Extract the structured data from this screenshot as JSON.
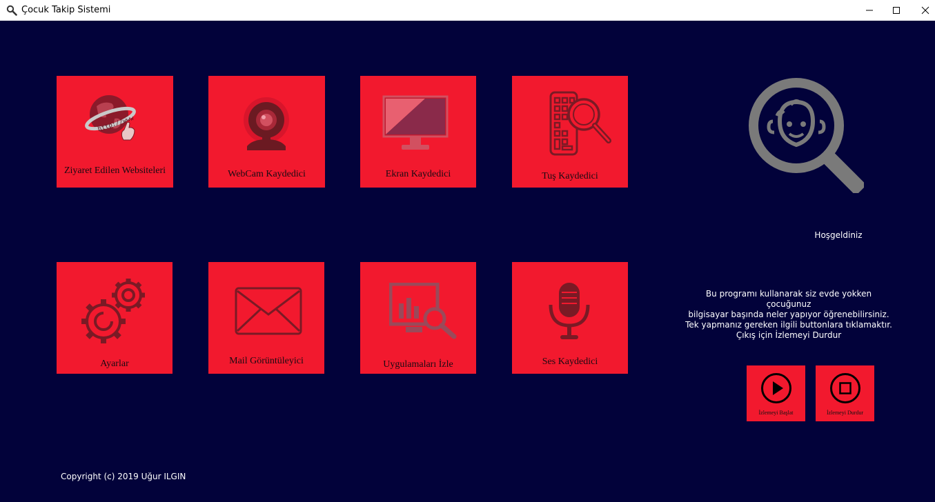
{
  "window": {
    "title": "Çocuk Takip Sistemi",
    "app_icon": "magnifier-icon",
    "controls": [
      "minimize-icon",
      "maximize-icon",
      "close-icon"
    ]
  },
  "tiles": [
    {
      "label": "Ziyaret Edilen Websiteleri",
      "icon": "globe-www-icon"
    },
    {
      "label": "WebCam Kaydedici",
      "icon": "webcam-icon"
    },
    {
      "label": "Ekran Kaydedici",
      "icon": "monitor-icon"
    },
    {
      "label": "Tuş Kaydedici",
      "icon": "keyboard-search-icon"
    },
    {
      "label": "Ayarlar",
      "icon": "gears-icon"
    },
    {
      "label": "Mail Görüntüleyici",
      "icon": "envelope-icon"
    },
    {
      "label": "Uygulamaları İzle",
      "icon": "app-monitor-icon"
    },
    {
      "label": "Ses  Kaydedici",
      "icon": "microphone-icon"
    }
  ],
  "sidebar": {
    "logo_icon": "child-magnifier-icon",
    "welcome": "Hoşgeldiniz",
    "description": [
      "Bu programı kullanarak siz evde yokken çocuğunuz",
      "bilgisayar başında neler yapıyor öğrenebilirsiniz.",
      "Tek yapmanız gereken ilgili buttonlara tıklamaktır.",
      "Çıkış için İzlemeyi Durdur"
    ],
    "start_label": "İzlemeyi Başlat",
    "stop_label": "İzlemeyi Durdur"
  },
  "footer": {
    "copyright": "Copyright (c) 2019 Uğur ILGIN"
  },
  "colors": {
    "background": "#02023a",
    "tile": "#f2192e",
    "icon_gray": "#7a7a7a"
  }
}
